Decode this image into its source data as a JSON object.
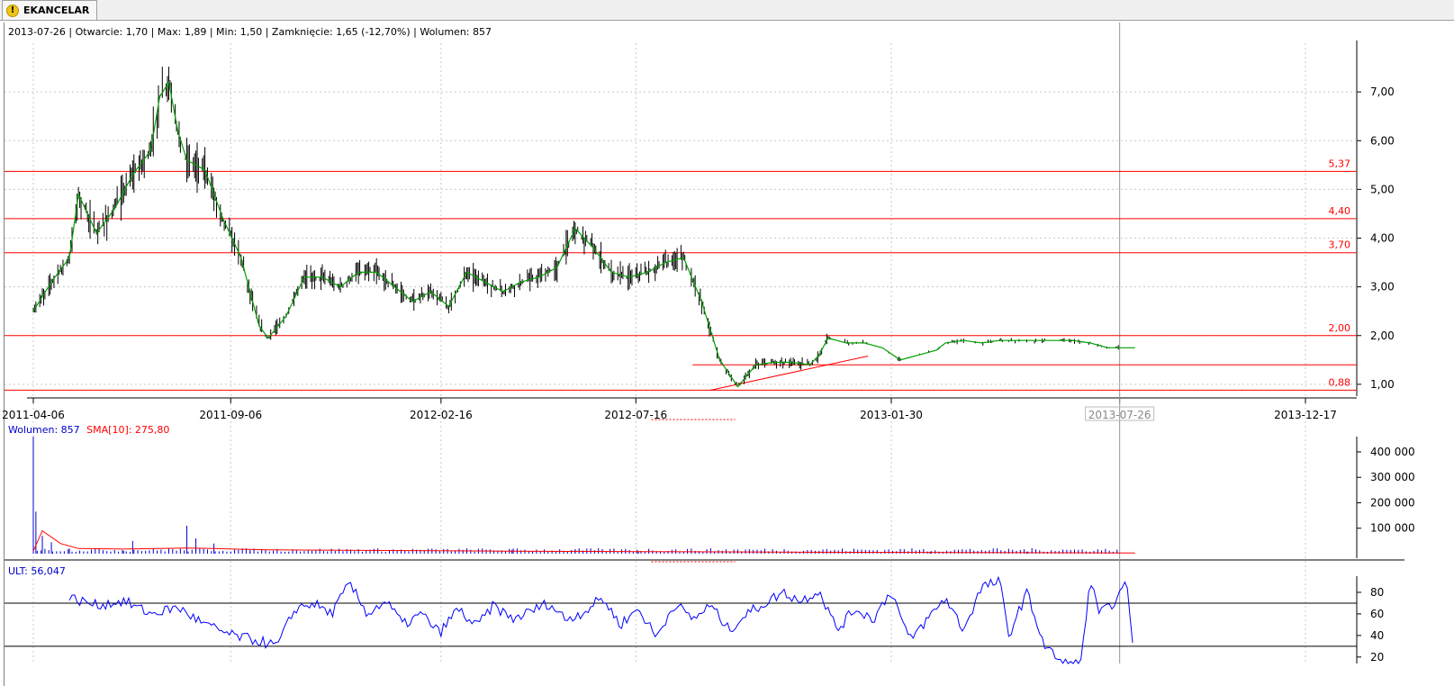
{
  "tab": {
    "label": "EKANCELAR",
    "icon": "warning-icon"
  },
  "header_info": "2013-07-26 | Otwarcie: 1,70 | Max: 1,89 | Min: 1,50 | Zamknięcie: 1,65 (-12,70%)  | Wolumen: 857",
  "volume_info": {
    "label": "Wolumen: 857",
    "sma_label": "SMA[10]: 275,80"
  },
  "ult_info": "ULT: 56,047",
  "colors": {
    "price": "#000000",
    "sma": "#00a000",
    "support": "#ff0000",
    "volume": "#0000cc",
    "volume_sma": "#ff0000",
    "ult": "#0000ff"
  },
  "chart_data": [
    {
      "type": "line",
      "name": "price",
      "x_ticks": [
        "2011-04-06",
        "2011-09-06",
        "2012-02-16",
        "2012-07-16",
        "2013-01-30",
        "2013-07-26",
        "2013-12-17"
      ],
      "y_ticks": [
        "1,00",
        "2,00",
        "3,00",
        "4,00",
        "5,00",
        "6,00",
        "7,00"
      ],
      "ylim": [
        0.85,
        8.0
      ],
      "horizontal_levels": [
        {
          "value": 5.37,
          "label": "5,37"
        },
        {
          "value": 4.4,
          "label": "4,40"
        },
        {
          "value": 3.7,
          "label": "3,70"
        },
        {
          "value": 2.0,
          "label": "2,00"
        },
        {
          "value": 0.88,
          "label": "0,88"
        }
      ],
      "support_line_value": 1.4,
      "trendline": {
        "from": [
          "2012-09-12",
          0.88
        ],
        "to": [
          "2013-01-12",
          1.58
        ]
      },
      "series_points": [
        [
          "2011-04-06",
          2.5
        ],
        [
          "2011-04-20",
          3.1
        ],
        [
          "2011-05-04",
          3.6
        ],
        [
          "2011-05-11",
          4.9
        ],
        [
          "2011-05-25",
          4.1
        ],
        [
          "2011-06-08",
          4.6
        ],
        [
          "2011-06-22",
          5.3
        ],
        [
          "2011-07-06",
          5.8
        ],
        [
          "2011-07-13",
          6.9
        ],
        [
          "2011-07-20",
          7.2
        ],
        [
          "2011-07-27",
          6.2
        ],
        [
          "2011-08-03",
          5.6
        ],
        [
          "2011-08-17",
          5.4
        ],
        [
          "2011-08-31",
          4.4
        ],
        [
          "2011-09-14",
          3.6
        ],
        [
          "2011-09-28",
          2.2
        ],
        [
          "2011-10-05",
          1.95
        ],
        [
          "2011-10-19",
          2.4
        ],
        [
          "2011-11-02",
          3.2
        ],
        [
          "2011-11-16",
          3.2
        ],
        [
          "2011-11-30",
          3.0
        ],
        [
          "2011-12-14",
          3.3
        ],
        [
          "2011-12-28",
          3.3
        ],
        [
          "2012-01-11",
          3.0
        ],
        [
          "2012-01-25",
          2.7
        ],
        [
          "2012-02-08",
          2.9
        ],
        [
          "2012-02-22",
          2.6
        ],
        [
          "2012-03-07",
          3.3
        ],
        [
          "2012-03-21",
          3.1
        ],
        [
          "2012-04-04",
          2.9
        ],
        [
          "2012-04-18",
          3.1
        ],
        [
          "2012-05-02",
          3.2
        ],
        [
          "2012-05-16",
          3.4
        ],
        [
          "2012-05-30",
          4.2
        ],
        [
          "2012-06-13",
          3.8
        ],
        [
          "2012-06-27",
          3.3
        ],
        [
          "2012-07-11",
          3.2
        ],
        [
          "2012-07-25",
          3.3
        ],
        [
          "2012-08-08",
          3.5
        ],
        [
          "2012-08-22",
          3.6
        ],
        [
          "2012-09-05",
          2.7
        ],
        [
          "2012-09-19",
          1.5
        ],
        [
          "2012-10-03",
          0.95
        ],
        [
          "2012-10-17",
          1.4
        ],
        [
          "2012-10-31",
          1.45
        ],
        [
          "2012-11-14",
          1.45
        ],
        [
          "2012-11-28",
          1.4
        ],
        [
          "2012-12-05",
          1.6
        ],
        [
          "2012-12-12",
          1.95
        ],
        [
          "2012-12-26",
          1.85
        ],
        [
          "2013-01-09",
          1.85
        ],
        [
          "2013-01-23",
          1.75
        ],
        [
          "2013-02-06",
          1.5
        ],
        [
          "2013-02-20",
          1.6
        ],
        [
          "2013-03-06",
          1.7
        ],
        [
          "2013-03-13",
          1.85
        ],
        [
          "2013-03-27",
          1.9
        ],
        [
          "2013-04-10",
          1.85
        ],
        [
          "2013-04-24",
          1.9
        ],
        [
          "2013-05-08",
          1.9
        ],
        [
          "2013-05-22",
          1.9
        ],
        [
          "2013-06-05",
          1.9
        ],
        [
          "2013-06-19",
          1.9
        ],
        [
          "2013-07-03",
          1.85
        ],
        [
          "2013-07-17",
          1.75
        ],
        [
          "2013-07-26",
          1.75
        ],
        [
          "2013-08-07",
          1.75
        ]
      ]
    },
    {
      "type": "bar",
      "name": "volume",
      "y_ticks": [
        "100 000",
        "200 000",
        "300 000",
        "400 000"
      ],
      "ylim": [
        0,
        460000
      ],
      "spikes": [
        [
          "2011-04-06",
          460000
        ],
        [
          "2011-04-08",
          165000
        ],
        [
          "2011-04-13",
          70000
        ],
        [
          "2011-04-20",
          45000
        ],
        [
          "2011-05-04",
          20000
        ],
        [
          "2011-06-15",
          12000
        ],
        [
          "2011-06-22",
          50000
        ],
        [
          "2011-07-20",
          20000
        ],
        [
          "2011-08-03",
          110000
        ],
        [
          "2011-08-10",
          60000
        ],
        [
          "2011-08-24",
          40000
        ],
        [
          "2011-09-21",
          15000
        ],
        [
          "2012-04-11",
          15000
        ],
        [
          "2012-05-30",
          12000
        ],
        [
          "2012-06-20",
          15000
        ],
        [
          "2012-07-18",
          10000
        ],
        [
          "2013-03-01",
          8000
        ],
        [
          "2013-05-15",
          8000
        ],
        [
          "2013-07-26",
          857
        ]
      ],
      "sma": [
        [
          "2011-04-06",
          10000
        ],
        [
          "2011-04-13",
          90000
        ],
        [
          "2011-04-27",
          40000
        ],
        [
          "2011-05-11",
          20000
        ],
        [
          "2011-06-15",
          18000
        ],
        [
          "2011-08-03",
          22000
        ],
        [
          "2011-08-24",
          20000
        ],
        [
          "2011-10-05",
          15000
        ],
        [
          "2012-04-11",
          10000
        ],
        [
          "2012-07-18",
          8000
        ],
        [
          "2012-11-01",
          6000
        ],
        [
          "2013-08-07",
          3000
        ]
      ]
    },
    {
      "type": "line",
      "name": "ULT",
      "y_ticks": [
        "20",
        "40",
        "60",
        "80"
      ],
      "ylim": [
        14,
        95
      ],
      "levels": [
        70,
        30
      ],
      "series_points": [
        [
          "2011-05-04",
          75
        ],
        [
          "2011-05-25",
          68
        ],
        [
          "2011-06-15",
          72
        ],
        [
          "2011-07-06",
          60
        ],
        [
          "2011-07-27",
          66
        ],
        [
          "2011-08-17",
          50
        ],
        [
          "2011-09-07",
          40
        ],
        [
          "2011-09-28",
          35
        ],
        [
          "2011-10-12",
          30
        ],
        [
          "2011-10-26",
          65
        ],
        [
          "2011-11-09",
          70
        ],
        [
          "2011-11-23",
          60
        ],
        [
          "2011-12-07",
          88
        ],
        [
          "2011-12-21",
          60
        ],
        [
          "2012-01-04",
          72
        ],
        [
          "2012-01-18",
          50
        ],
        [
          "2012-02-01",
          60
        ],
        [
          "2012-02-15",
          42
        ],
        [
          "2012-02-29",
          65
        ],
        [
          "2012-03-14",
          48
        ],
        [
          "2012-03-28",
          68
        ],
        [
          "2012-04-11",
          55
        ],
        [
          "2012-04-25",
          62
        ],
        [
          "2012-05-09",
          70
        ],
        [
          "2012-05-23",
          55
        ],
        [
          "2012-06-06",
          62
        ],
        [
          "2012-06-20",
          75
        ],
        [
          "2012-07-04",
          50
        ],
        [
          "2012-07-18",
          65
        ],
        [
          "2012-08-01",
          38
        ],
        [
          "2012-08-15",
          70
        ],
        [
          "2012-08-29",
          55
        ],
        [
          "2012-09-12",
          68
        ],
        [
          "2012-09-26",
          45
        ],
        [
          "2012-10-10",
          60
        ],
        [
          "2012-10-24",
          70
        ],
        [
          "2012-11-07",
          80
        ],
        [
          "2012-11-21",
          72
        ],
        [
          "2012-12-05",
          82
        ],
        [
          "2012-12-19",
          45
        ],
        [
          "2013-01-02",
          65
        ],
        [
          "2013-01-16",
          55
        ],
        [
          "2013-01-30",
          82
        ],
        [
          "2013-02-13",
          35
        ],
        [
          "2013-02-27",
          55
        ],
        [
          "2013-03-13",
          75
        ],
        [
          "2013-03-27",
          45
        ],
        [
          "2013-04-10",
          85
        ],
        [
          "2013-04-24",
          90
        ],
        [
          "2013-05-01",
          40
        ],
        [
          "2013-05-15",
          80
        ],
        [
          "2013-05-29",
          30
        ],
        [
          "2013-06-12",
          14
        ],
        [
          "2013-06-26",
          14
        ],
        [
          "2013-07-03",
          92
        ],
        [
          "2013-07-10",
          60
        ],
        [
          "2013-07-17",
          65
        ],
        [
          "2013-07-24",
          75
        ],
        [
          "2013-08-01",
          88
        ],
        [
          "2013-08-05",
          30
        ]
      ]
    }
  ]
}
